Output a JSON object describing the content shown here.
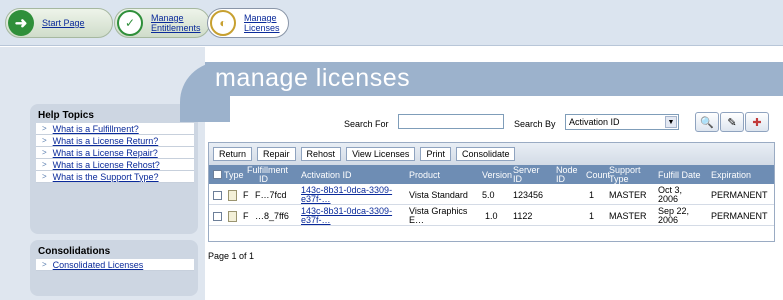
{
  "nav": {
    "start": "Start Page",
    "entitlements_1": "Manage",
    "entitlements_2": "Entitlements",
    "licenses_1": "Manage",
    "licenses_2": "Licenses"
  },
  "page_title": "manage licenses",
  "help": {
    "title": "Help Topics",
    "items": [
      "What is a Fulfillment?",
      "What is a License Return?",
      "What is a License Repair?",
      "What is a License Rehost?",
      "What is the Support Type?"
    ]
  },
  "consolidations": {
    "title": "Consolidations",
    "items": [
      "Consolidated Licenses"
    ]
  },
  "search": {
    "for_label": "Search For",
    "query": "",
    "by_label": "Search By",
    "by_value": "Activation ID"
  },
  "toolbar": [
    "Return",
    "Repair",
    "Rehost",
    "View Licenses",
    "Print",
    "Consolidate"
  ],
  "columns": {
    "type": "Type",
    "fulfillment_1": "Fulfillment",
    "fulfillment_2": "ID",
    "activation": "Activation ID",
    "product": "Product",
    "version": "Version",
    "server_1": "Server",
    "server_2": "ID",
    "node_1": "Node",
    "node_2": "ID",
    "count": "Count",
    "support_1": "Support",
    "support_2": "Type",
    "fulfill_date": "Fulfill Date",
    "expiration": "Expiration"
  },
  "rows": [
    {
      "type": "F",
      "fulfillment": "F…7fcd",
      "activation_1": "143c-8b31-0dca-3309-",
      "activation_2": "e37f-…",
      "product_1": "Vista Standard",
      "product_2": "",
      "version": "5.0",
      "server": "123456",
      "node": "",
      "count": "1",
      "support": "MASTER",
      "date_1": "Oct 3,",
      "date_2": "2006",
      "expiration": "PERMANENT"
    },
    {
      "type": "F",
      "fulfillment": "…8_7ff6",
      "activation_1": "143c-8b31-0dca-3309-",
      "activation_2": "e37f-…",
      "product_1": "Vista Graphics",
      "product_2": "E…",
      "version": "1.0",
      "server": "1122",
      "node": "",
      "count": "1",
      "support": "MASTER",
      "date_1": "Sep 22,",
      "date_2": "2006",
      "expiration": "PERMANENT"
    }
  ],
  "pager": "Page 1 of 1",
  "colors": {
    "banner": "#9cb2cc",
    "table_header": "#6e8db4",
    "sidebar": "#dfe6ef"
  }
}
